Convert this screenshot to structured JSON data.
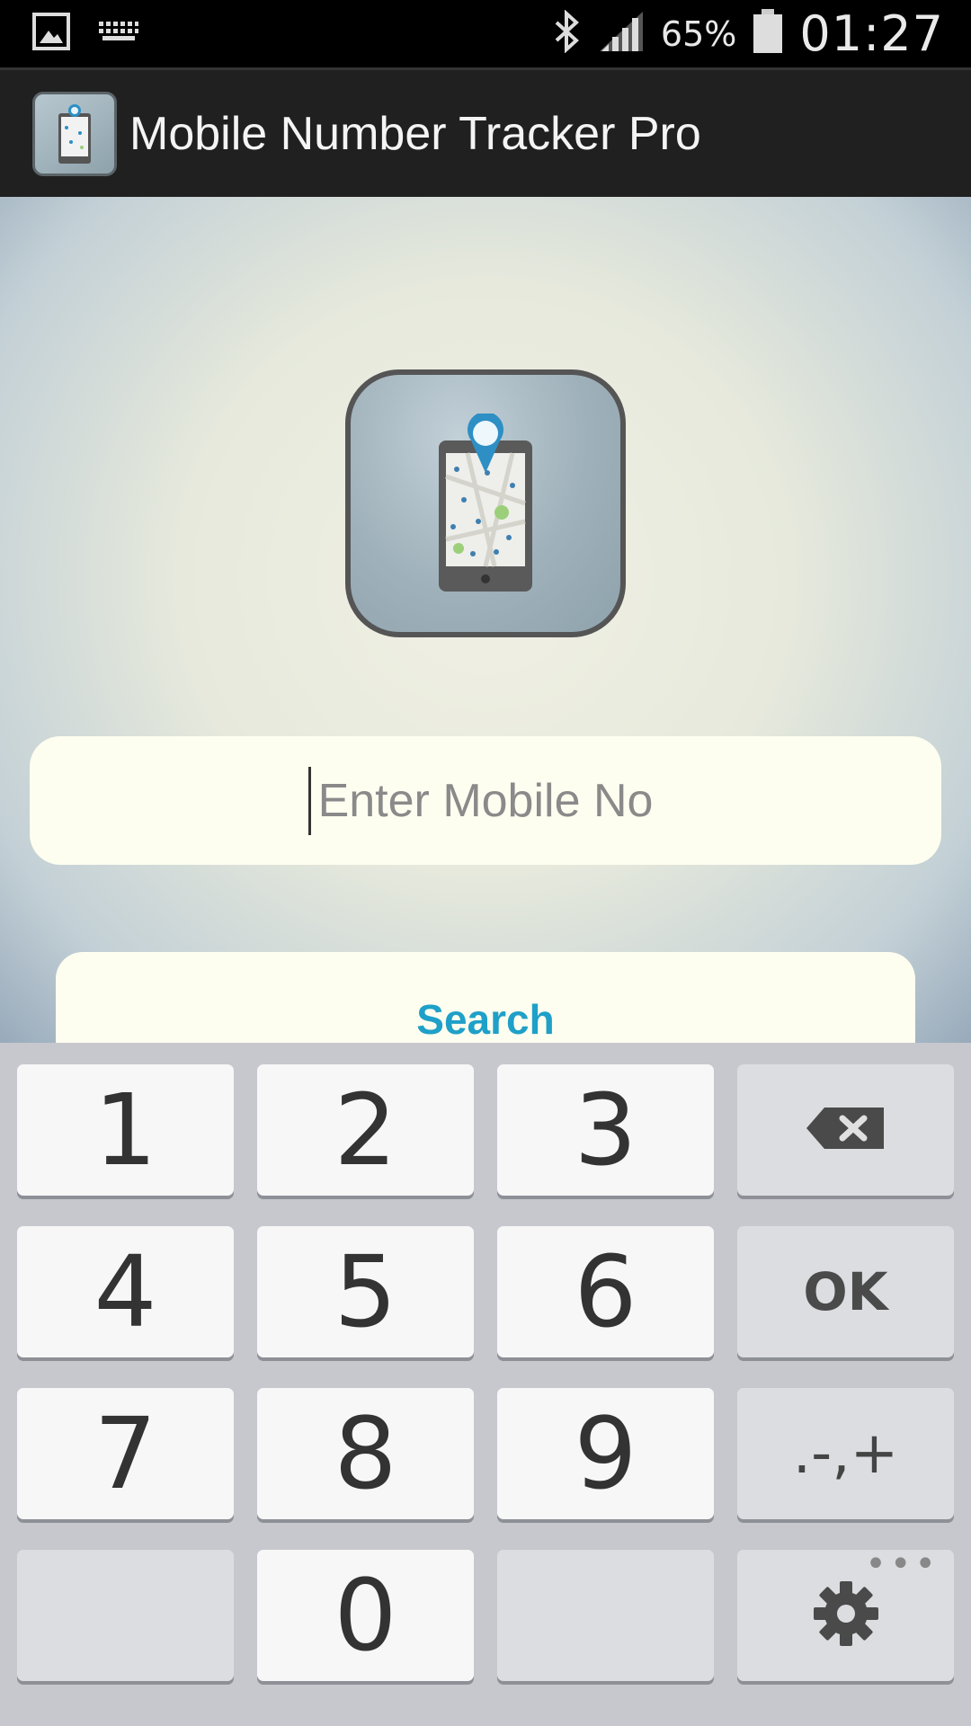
{
  "status_bar": {
    "icons": [
      "gallery-icon",
      "keyboard-icon",
      "bluetooth-icon",
      "signal-icon",
      "battery-icon"
    ],
    "battery_percent": "65%",
    "time": "01:27"
  },
  "action_bar": {
    "title": "Mobile Number Tracker Pro"
  },
  "main": {
    "mobile_input": {
      "placeholder": "Enter Mobile No",
      "value": ""
    },
    "search_label": "Search"
  },
  "keyboard": {
    "keys": [
      "1",
      "2",
      "3",
      "4",
      "5",
      "6",
      "7",
      "8",
      "9",
      "0"
    ],
    "ok_label": "OK",
    "symbols_label": ".-,+"
  },
  "colors": {
    "accent": "#1fa0c8",
    "input_bg": "#fefef0",
    "keyboard_bg": "#c6c8cd"
  }
}
